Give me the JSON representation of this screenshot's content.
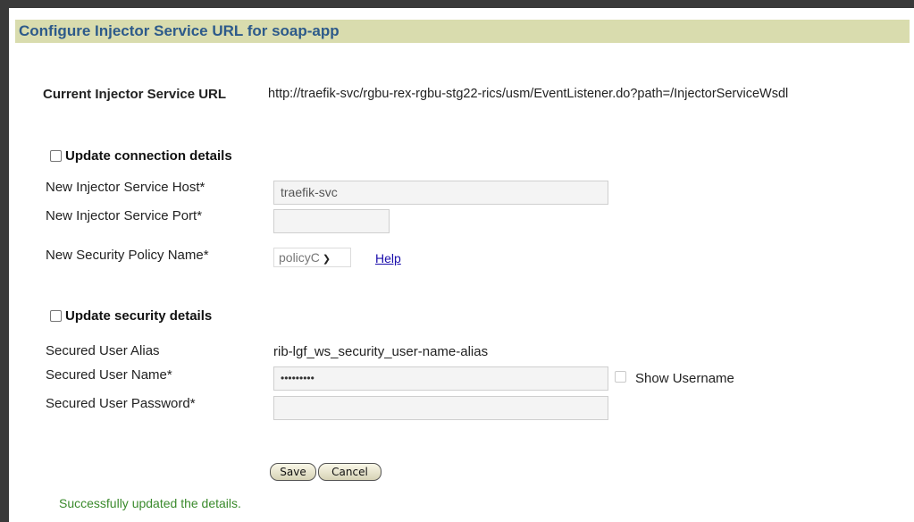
{
  "header": {
    "title": "Configure Injector Service URL for soap-app"
  },
  "current_url": {
    "label": "Current Injector Service URL",
    "value": "http://traefik-svc/rgbu-rex-rgbu-stg22-rics/usm/EventListener.do?path=/InjectorServiceWsdl"
  },
  "connection": {
    "section_label": "Update connection details",
    "checked": false,
    "host_label": "New Injector Service Host*",
    "host_value": "traefik-svc",
    "port_label": "New Injector Service Port*",
    "port_value": "",
    "policy_label": "New Security Policy Name*",
    "policy_selected": "policyC",
    "help_link": "Help"
  },
  "security": {
    "section_label": "Update security details",
    "checked": false,
    "alias_label": "Secured User Alias",
    "alias_value": "rib-lgf_ws_security_user-name-alias",
    "username_label": "Secured User Name*",
    "username_value": "•••••••••",
    "show_username_label": "Show Username",
    "password_label": "Secured User Password*",
    "password_value": ""
  },
  "actions": {
    "save_label": "Save",
    "cancel_label": "Cancel"
  },
  "status": {
    "message": "Successfully updated the details."
  }
}
